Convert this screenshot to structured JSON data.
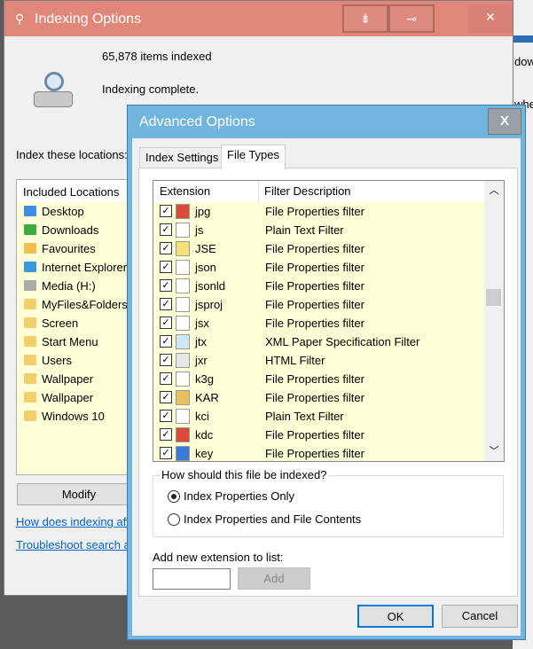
{
  "background_window": {
    "fragments": [
      "dow",
      "whe"
    ]
  },
  "main": {
    "title": "Indexing Options",
    "items_indexed": "65,878 items indexed",
    "status": "Indexing complete.",
    "locations_label": "Index these locations:",
    "column_header": "Included Locations",
    "locations": [
      {
        "label": "Desktop",
        "icon": "desktop-folder-icon"
      },
      {
        "label": "Downloads",
        "icon": "downloads-icon"
      },
      {
        "label": "Favourites",
        "icon": "favourites-icon"
      },
      {
        "label": "Internet Explorer",
        "icon": "internet-explorer-icon"
      },
      {
        "label": "Media (H:)",
        "icon": "drive-icon"
      },
      {
        "label": "MyFiles&Folders",
        "icon": "folder-icon"
      },
      {
        "label": "Screen",
        "icon": "folder-icon"
      },
      {
        "label": "Start Menu",
        "icon": "folder-icon"
      },
      {
        "label": "Users",
        "icon": "folder-icon"
      },
      {
        "label": "Wallpaper",
        "icon": "folder-icon"
      },
      {
        "label": "Wallpaper",
        "icon": "folder-icon"
      },
      {
        "label": "Windows 10",
        "icon": "folder-icon"
      }
    ],
    "modify_label": "Modify",
    "link1": "How does indexing aff",
    "link2": "Troubleshoot search a",
    "titlebar_color": "#e0877a"
  },
  "advanced": {
    "title": "Advanced Options",
    "close_label": "X",
    "tabs": [
      {
        "label": "Index Settings",
        "active": false
      },
      {
        "label": "File Types",
        "active": true
      }
    ],
    "columns": [
      "Extension",
      "Filter Description"
    ],
    "rows": [
      {
        "ext": "jpg",
        "desc": "File Properties filter",
        "checked": true
      },
      {
        "ext": "js",
        "desc": "Plain Text Filter",
        "checked": true
      },
      {
        "ext": "JSE",
        "desc": "File Properties filter",
        "checked": true
      },
      {
        "ext": "json",
        "desc": "File Properties filter",
        "checked": true
      },
      {
        "ext": "jsonld",
        "desc": "File Properties filter",
        "checked": true
      },
      {
        "ext": "jsproj",
        "desc": "File Properties filter",
        "checked": true
      },
      {
        "ext": "jsx",
        "desc": "File Properties filter",
        "checked": true
      },
      {
        "ext": "jtx",
        "desc": "XML Paper Specification Filter",
        "checked": true
      },
      {
        "ext": "jxr",
        "desc": "HTML Filter",
        "checked": true
      },
      {
        "ext": "k3g",
        "desc": "File Properties filter",
        "checked": true
      },
      {
        "ext": "KAR",
        "desc": "File Properties filter",
        "checked": true
      },
      {
        "ext": "kci",
        "desc": "Plain Text Filter",
        "checked": true
      },
      {
        "ext": "kdc",
        "desc": "File Properties filter",
        "checked": true
      },
      {
        "ext": "key",
        "desc": "File Properties filter",
        "checked": true
      }
    ],
    "group_label": "How should this file be indexed?",
    "radio1": "Index Properties Only",
    "radio2": "Index Properties and File Contents",
    "radio_selected": 1,
    "add_label": "Add new extension to list:",
    "add_value": "",
    "add_button": "Add",
    "ok": "OK",
    "cancel": "Cancel",
    "titlebar_color": "#6fb5dd"
  }
}
